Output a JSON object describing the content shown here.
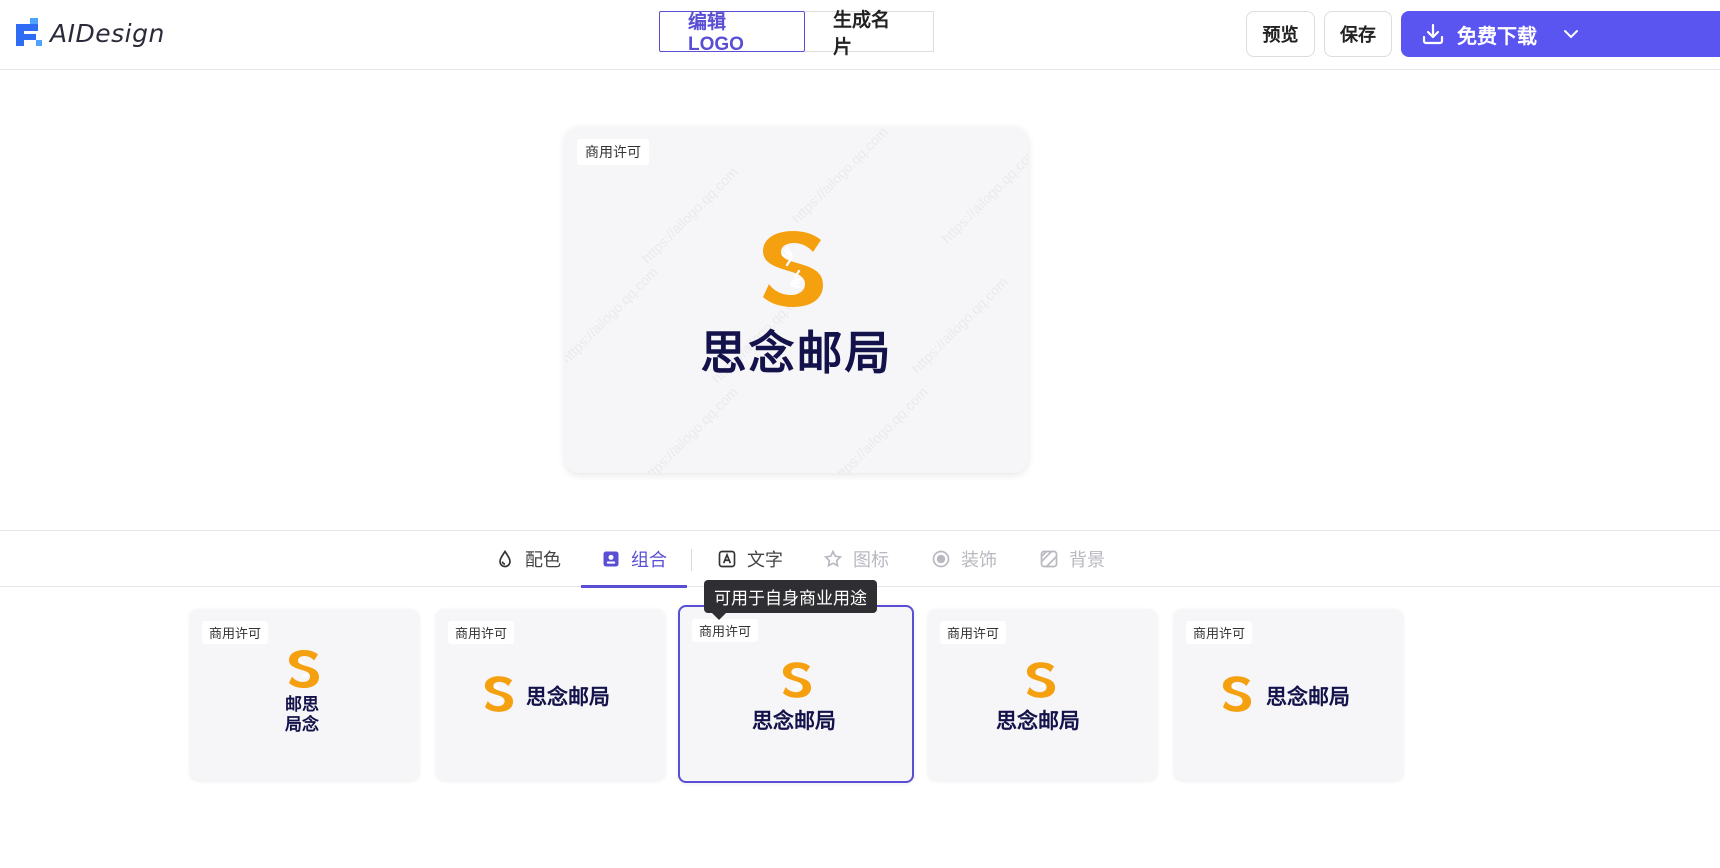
{
  "header": {
    "app_name": "AIDesign",
    "modes": [
      {
        "label": "编辑LOGO",
        "active": true
      },
      {
        "label": "生成名片",
        "active": false
      }
    ],
    "preview_label": "预览",
    "save_label": "保存",
    "download_label": "免费下载"
  },
  "canvas": {
    "badge": "商用许可",
    "brand_name": "思念邮局",
    "watermark": "https://ailogo.qq.com"
  },
  "tabs": [
    {
      "label": "配色",
      "icon": "droplet-icon",
      "state": "normal"
    },
    {
      "label": "组合",
      "icon": "layout-icon",
      "state": "active"
    },
    {
      "label": "文字",
      "icon": "text-icon",
      "state": "normal"
    },
    {
      "label": "图标",
      "icon": "star-icon",
      "state": "disabled"
    },
    {
      "label": "装饰",
      "icon": "circle-icon",
      "state": "disabled"
    },
    {
      "label": "背景",
      "icon": "background-icon",
      "state": "disabled"
    }
  ],
  "tooltip": "可用于自身商业用途",
  "thumbnails": [
    {
      "badge": "商用许可",
      "layout": "stacked-grid",
      "line1": "邮思",
      "line2": "局念"
    },
    {
      "badge": "商用许可",
      "layout": "horizontal",
      "text": "思念邮局"
    },
    {
      "badge": "商用许可",
      "layout": "vertical",
      "text": "思念邮局",
      "selected": true
    },
    {
      "badge": "商用许可",
      "layout": "vertical",
      "text": "思念邮局"
    },
    {
      "badge": "商用许可",
      "layout": "horizontal",
      "text": "思念邮局"
    }
  ],
  "colors": {
    "accent": "#5a4fd4",
    "download_bg": "#5a54f0",
    "logo_orange": "#f5a00e",
    "brand_navy": "#14124a"
  }
}
